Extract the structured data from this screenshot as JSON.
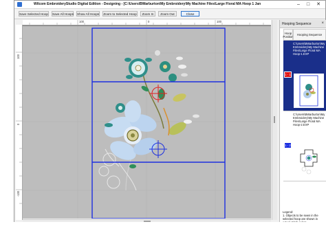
{
  "window": {
    "title": "Wilcom EmbroideryStudio Digital Edition - Designing - [C:\\Users\\BWarburton\\My Embroidery\\My Machine Files\\Large Floral MA Hoop 1    Janome] - [bswarb@gm",
    "controls": {
      "minimize": "–",
      "maximize": "□",
      "close": "✕"
    }
  },
  "toolbar": {
    "buttons": [
      {
        "label": "Save Selected Hoop"
      },
      {
        "label": "Save All Hoops"
      },
      {
        "label": "Show All Hoops"
      },
      {
        "label": "Zoom to Selected Hoop"
      },
      {
        "label": "Zoom In"
      },
      {
        "label": "Zoom Out"
      },
      {
        "label": "Close"
      }
    ]
  },
  "rulers": {
    "horizontal": [
      "100",
      "0",
      "100"
    ],
    "vertical": [
      "100",
      "0",
      "-100"
    ]
  },
  "panel": {
    "title": "Hooping Sequence",
    "close_icon": "×",
    "col_position": "Hoop Position",
    "col_sequence": "Hooping Sequence",
    "items": [
      {
        "position": "1 - 1",
        "path": "C:\\Users\\BWarburton\\My Embroidery\\My Machine Files\\Large Floral MA Hoop-1.EXP",
        "selected": true
      },
      {
        "position": "1 - 2",
        "path": "C:\\Users\\BWarburton\\My Embroidery\\My Machine Files\\Large Floral MA Hoop-2.EXP",
        "selected": false
      }
    ],
    "legend_title": "Legend:",
    "legend_text": "1. Objects to be sewn in the selected hoop are shown in actual stitch colors."
  },
  "colors": {
    "hoop_border": "#1c2fe0",
    "selected_row": "#1a2f8a",
    "position_badge": "#e01010",
    "canvas_bg": "#bdbdbd"
  }
}
